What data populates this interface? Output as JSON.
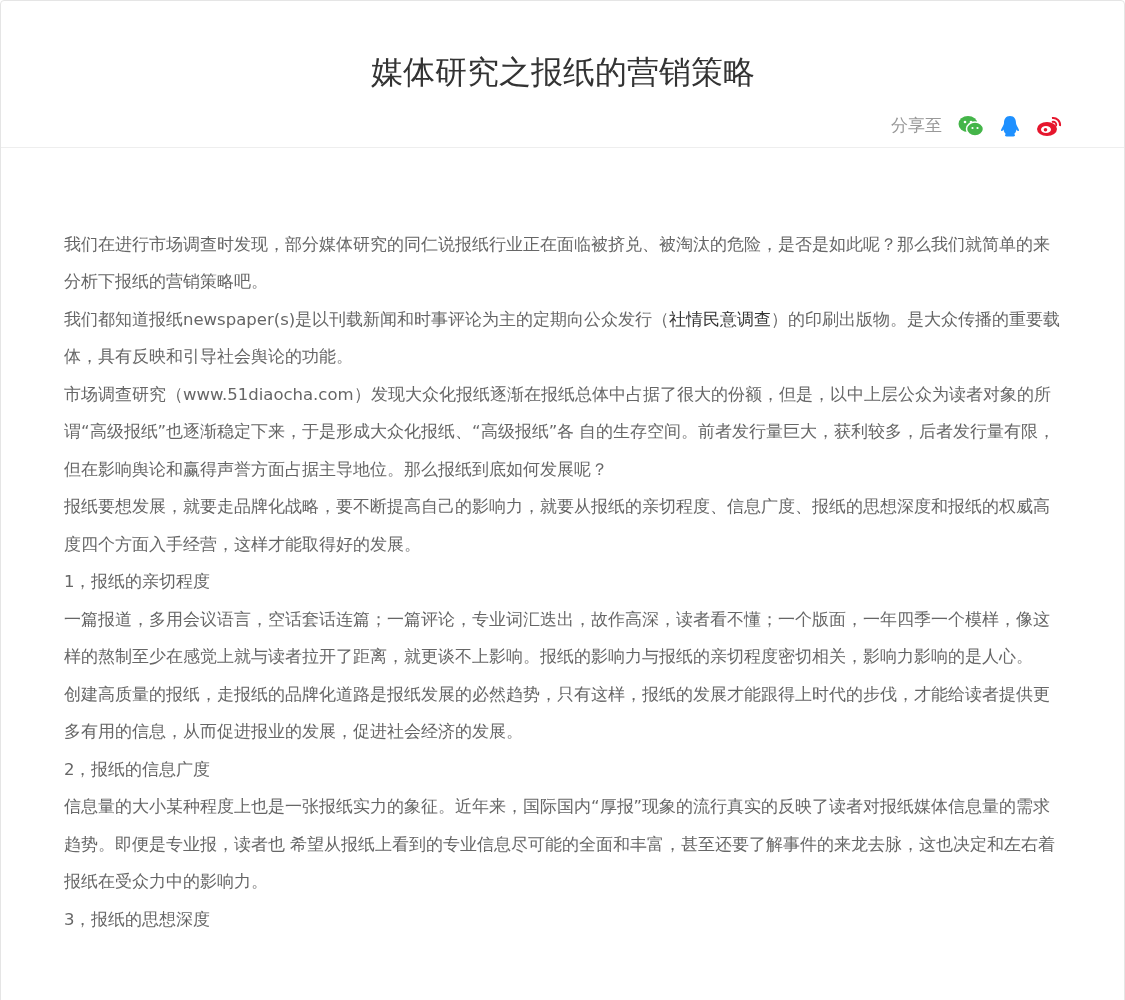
{
  "title": "媒体研究之报纸的营销策略",
  "share": {
    "label": "分享至"
  },
  "paragraphs": [
    {
      "parts": [
        {
          "kind": "text",
          "text": "我们在进行市场调查时发现，部分媒体研究的同仁说报纸行业正在面临被挤兑、被淘汰的危险，是否是如此呢？那么我们就简单的来分析下报纸的营销策略吧。"
        }
      ]
    },
    {
      "parts": [
        {
          "kind": "text",
          "text": "我们都知道报纸newspaper(s)是以刊载新闻和时事评论为主的定期向公众发行（"
        },
        {
          "kind": "link",
          "text": "社情民意调查"
        },
        {
          "kind": "text",
          "text": "）的印刷出版物。是大众传播的重要载体，具有反映和引导社会舆论的功能。"
        }
      ]
    },
    {
      "parts": [
        {
          "kind": "text",
          "text": "市场调查研究（www.51diaocha.com）发现大众化报纸逐渐在报纸总体中占据了很大的份额，但是，以中上层公众为读者对象的所谓“高级报纸”也逐渐稳定下来，于是形成大众化报纸、“高级报纸”各 自的生存空间。前者发行量巨大，获利较多，后者发行量有限，但在影响舆论和赢得声誉方面占据主导地位。那么报纸到底如何发展呢？"
        }
      ]
    },
    {
      "parts": [
        {
          "kind": "text",
          "text": "报纸要想发展，就要走品牌化战略，要不断提高自己的影响力，就要从报纸的亲切程度、信息广度、报纸的思想深度和报纸的权威高度四个方面入手经营，这样才能取得好的发展。"
        }
      ]
    },
    {
      "parts": [
        {
          "kind": "text",
          "text": "1，报纸的亲切程度"
        }
      ]
    },
    {
      "parts": [
        {
          "kind": "text",
          "text": "一篇报道，多用会议语言，空话套话连篇；一篇评论，专业词汇迭出，故作高深，读者看不懂；一个版面，一年四季一个模样，像这样的熬制至少在感觉上就与读者拉开了距离，就更谈不上影响。报纸的影响力与报纸的亲切程度密切相关，影响力影响的是人心。"
        }
      ]
    },
    {
      "parts": [
        {
          "kind": "text",
          "text": "创建高质量的报纸，走报纸的品牌化道路是报纸发展的必然趋势，只有这样，报纸的发展才能跟得上时代的步伐，才能给读者提供更多有用的信息，从而促进报业的发展，促进社会经济的发展。"
        }
      ]
    },
    {
      "parts": [
        {
          "kind": "text",
          "text": "2，报纸的信息广度"
        }
      ]
    },
    {
      "parts": [
        {
          "kind": "text",
          "text": "信息量的大小某种程度上也是一张报纸实力的象征。近年来，国际国内“厚报”现象的流行真实的反映了读者对报纸媒体信息量的需求趋势。即便是专业报，读者也 希望从报纸上看到的专业信息尽可能的全面和丰富，甚至还要了解事件的来龙去脉，这也决定和左右着报纸在受众力中的影响力。"
        }
      ]
    },
    {
      "parts": [
        {
          "kind": "text",
          "text": "3，报纸的思想深度"
        }
      ]
    }
  ]
}
